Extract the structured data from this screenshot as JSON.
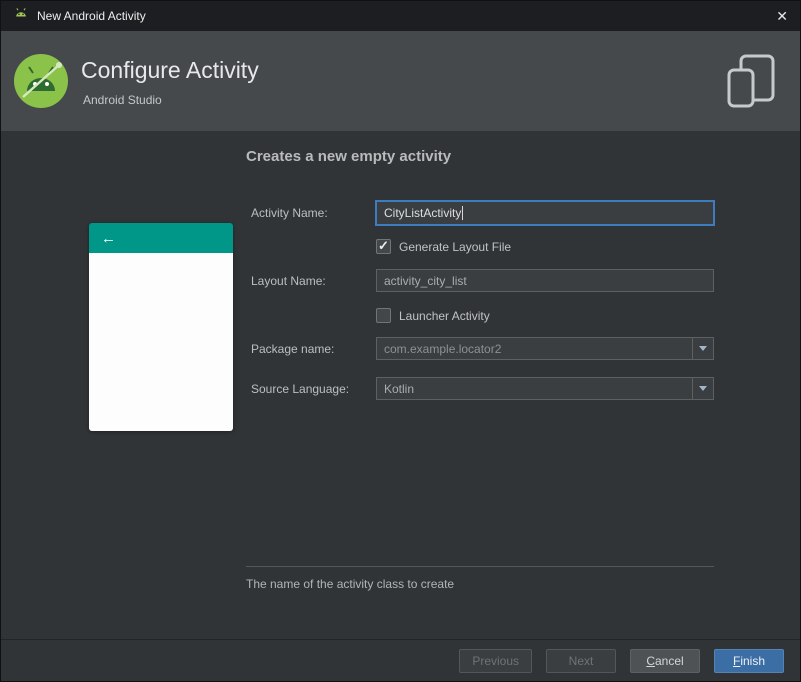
{
  "window": {
    "title": "New Android Activity",
    "close_icon": "✕"
  },
  "header": {
    "title": "Configure Activity",
    "subtitle": "Android Studio"
  },
  "preview": {
    "back_icon": "←"
  },
  "form": {
    "heading": "Creates a new empty activity",
    "activity_name_label": "Activity Name:",
    "activity_name_value": "CityListActivity",
    "generate_layout_label": "Generate Layout File",
    "generate_layout_checked": true,
    "layout_name_label": "Layout Name:",
    "layout_name_value": "activity_city_list",
    "launcher_label": "Launcher Activity",
    "launcher_checked": false,
    "package_label": "Package name:",
    "package_value": "com.example.locator2",
    "language_label": "Source Language:",
    "language_value": "Kotlin",
    "helper_text": "The name of the activity class to create"
  },
  "buttons": {
    "previous": "Previous",
    "next": "Next",
    "cancel_accel": "C",
    "cancel_rest": "ancel",
    "finish_accel": "F",
    "finish_rest": "inish"
  },
  "colors": {
    "accent_teal": "#009688",
    "focus_blue": "#3d7dbf",
    "finish_blue": "#3a6ea5"
  }
}
